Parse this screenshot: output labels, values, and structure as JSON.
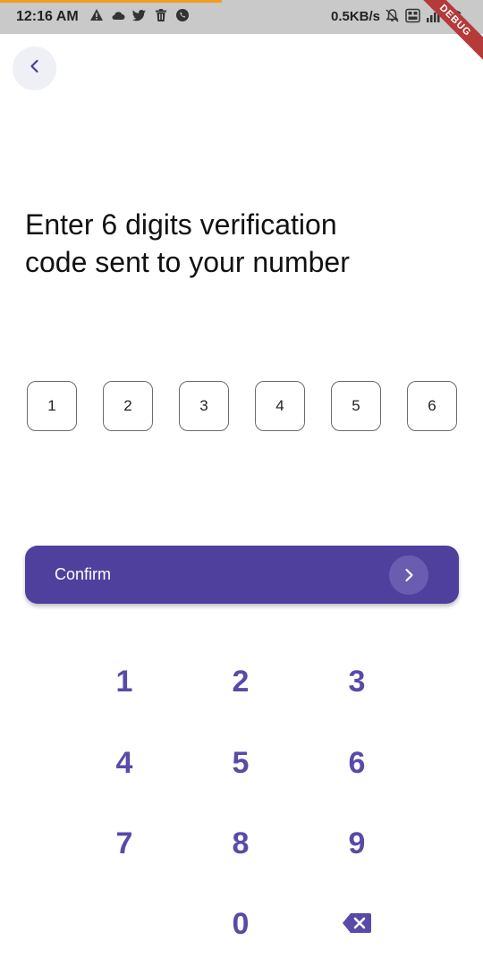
{
  "status_bar": {
    "time": "12:16 AM",
    "speed": "0.5KB/s",
    "left_icons": [
      "warning-icon",
      "cloud-icon",
      "twitter-icon",
      "trash-icon",
      "whatsapp-icon"
    ],
    "right_icons": [
      "bell-off-icon",
      "volte-icon",
      "signal-icon",
      "wifi-icon"
    ],
    "debug_label": "DEBUG",
    "accent": "#f39c22"
  },
  "back_button": {
    "icon": "chevron-left-icon"
  },
  "heading": {
    "line1": "Enter 6 digits verification",
    "line2": "code sent to your number"
  },
  "otp": {
    "digits": [
      "1",
      "2",
      "3",
      "4",
      "5",
      "6"
    ]
  },
  "confirm": {
    "label": "Confirm",
    "icon": "chevron-right-icon",
    "color": "#50409d"
  },
  "keypad": {
    "keys": [
      "1",
      "2",
      "3",
      "4",
      "5",
      "6",
      "7",
      "8",
      "9",
      "0"
    ],
    "backspace_icon": "backspace-icon",
    "color": "#5a4aa8"
  }
}
